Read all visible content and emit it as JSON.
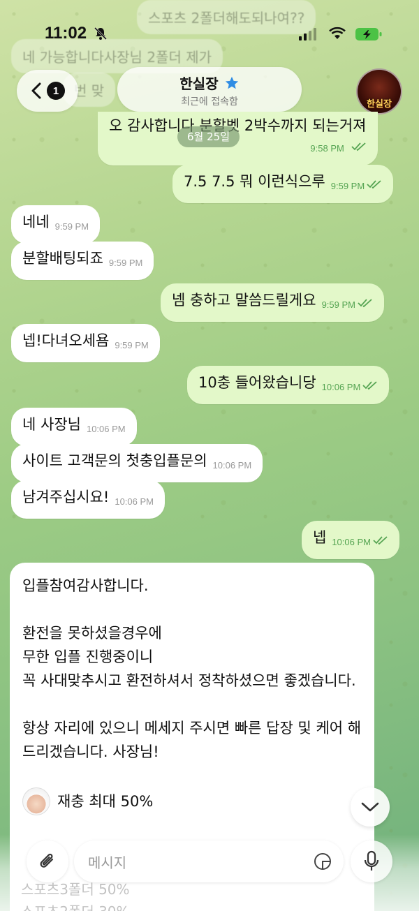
{
  "background_ghosts": {
    "top_bubble_1": "스포츠 2폴더해도되나여??",
    "top_bubble_2": "네 가능합니다사장님 2폴더 제가",
    "top_bubble_3": "번 맞",
    "bottom_1": "스포츠3폴더 50%",
    "bottom_2": "스포츠2폴더 30%"
  },
  "status_bar": {
    "time": "11:02"
  },
  "header": {
    "back_count": "1",
    "title": "한실장",
    "subtitle": "최근에 접속함",
    "avatar_text": "한실장"
  },
  "date_separator": "6월 25일",
  "messages": [
    {
      "dir": "out",
      "text": "오 감사합니다 분할벳 2박수까지 되는거져",
      "time": "9:58 PM"
    },
    {
      "dir": "out",
      "text": "7.5 7.5 뭐 이런식으루",
      "time": "9:59 PM"
    },
    {
      "dir": "in",
      "text": "네네",
      "time": "9:59 PM"
    },
    {
      "dir": "in",
      "text": "분할배팅되죠",
      "time": "9:59 PM"
    },
    {
      "dir": "out",
      "text": "넴 충하고 말씀드릴게요",
      "time": "9:59 PM"
    },
    {
      "dir": "in",
      "text": "넵!다녀오세욤",
      "time": "9:59 PM"
    },
    {
      "dir": "out",
      "text": "10충 들어왔습니당",
      "time": "10:06 PM"
    },
    {
      "dir": "in",
      "text": "네 사장님",
      "time": "10:06 PM"
    },
    {
      "dir": "in",
      "text": "사이트 고객문의 첫충입플문의",
      "time": "10:06 PM"
    },
    {
      "dir": "in",
      "text": "남겨주십시요!",
      "time": "10:06 PM"
    },
    {
      "dir": "out",
      "text": "넵",
      "time": "10:06 PM"
    }
  ],
  "long_message": {
    "line1": "입플참여감사합니다.",
    "line2": "환전을 못하셨을경우에\n무한 입플 진행중이니\n꼭 사대맞추시고 환전하셔서 정착하셨으면 좋겠습니다.",
    "line3": "항상 자리에 있으니 메세지 주시면 빠른 답장 및 케어 해드리겠습니다. 사장님!",
    "promo": "재충 최대 50%"
  },
  "input": {
    "placeholder": "메시지"
  },
  "colors": {
    "outgoing_bubble": "#e3f8c9",
    "incoming_bubble": "#ffffff",
    "check_green": "#55a452",
    "accent_blue": "#2f8de4"
  }
}
